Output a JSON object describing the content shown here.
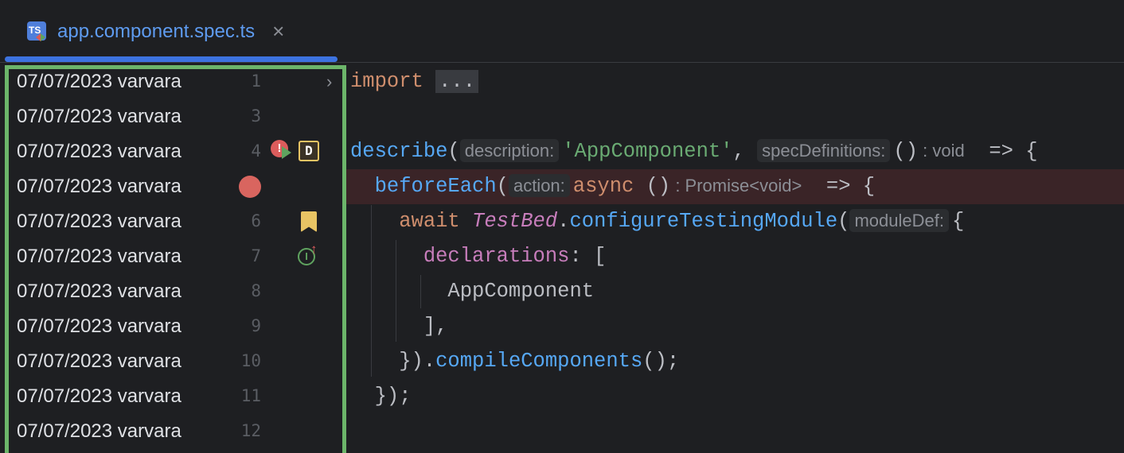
{
  "tab": {
    "icon": "typescript-test-file-icon",
    "icon_text": "TS",
    "filename": "app.component.spec.ts",
    "close": "×"
  },
  "gutter_rows": [
    {
      "date": "07/07/2023 varvara",
      "line": "1"
    },
    {
      "date": "07/07/2023 varvara",
      "line": "3"
    },
    {
      "date": "07/07/2023 varvara",
      "line": "4"
    },
    {
      "date": "07/07/2023 varvara",
      "line": ""
    },
    {
      "date": "07/07/2023 varvara",
      "line": "6"
    },
    {
      "date": "07/07/2023 varvara",
      "line": "7"
    },
    {
      "date": "07/07/2023 varvara",
      "line": "8"
    },
    {
      "date": "07/07/2023 varvara",
      "line": "9"
    },
    {
      "date": "07/07/2023 varvara",
      "line": "10"
    },
    {
      "date": "07/07/2023 varvara",
      "line": "11"
    },
    {
      "date": "07/07/2023 varvara",
      "line": "12"
    }
  ],
  "gutter_icons": {
    "fold": "›",
    "error": "!",
    "bookmark_letter": "D",
    "implemented": "I",
    "implemented_arrow": "↑"
  },
  "code": {
    "l1": [
      "import ",
      "..."
    ],
    "l4": [
      "describe",
      "(",
      "description:",
      "'AppComponent'",
      ", ",
      "specDefinitions:",
      "()",
      " : void",
      "  => {"
    ],
    "l5": [
      "  ",
      "beforeEach",
      "(",
      "action:",
      "async",
      " ()",
      " : Promise<void>",
      "  => {"
    ],
    "l6": [
      "    ",
      "await ",
      "TestBed",
      ".",
      "configureTestingModule",
      "(",
      "moduleDef:",
      "{"
    ],
    "l7": [
      "      ",
      "declarations",
      ": ["
    ],
    "l8": [
      "        AppComponent"
    ],
    "l9": [
      "      ],"
    ],
    "l10": [
      "    }).",
      "compileComponents",
      "();"
    ],
    "l11": [
      "  });"
    ]
  }
}
